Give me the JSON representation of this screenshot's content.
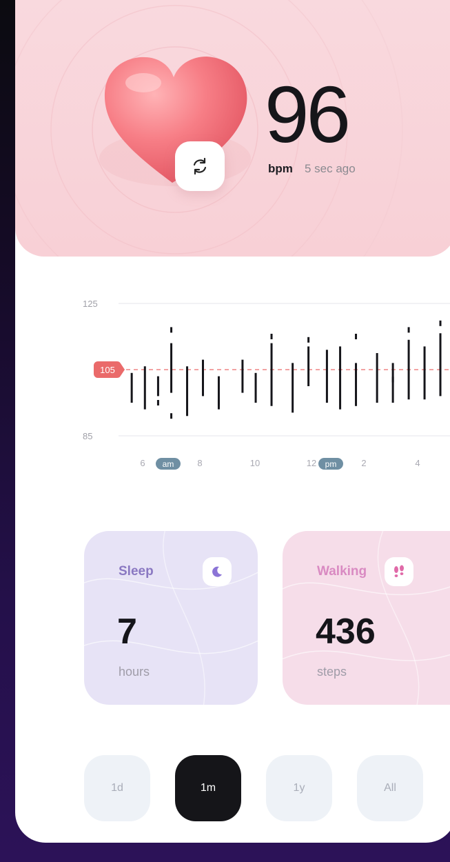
{
  "heart_rate": {
    "value": "96",
    "unit": "bpm",
    "updated": "5 sec ago"
  },
  "chart_data": {
    "type": "bar",
    "y_ticks": [
      "125",
      "105",
      "85"
    ],
    "ylim": [
      85,
      125
    ],
    "reference_value": 105,
    "reference_label": "105",
    "x_ticks": [
      "6",
      "8",
      "10",
      "12",
      "2",
      "4"
    ],
    "am_badge": "am",
    "pm_badge": "pm",
    "ranges": [
      {
        "x": 0.5,
        "low": 95,
        "high": 104
      },
      {
        "x": 1.0,
        "low": 93,
        "high": 106
      },
      {
        "x": 1.5,
        "low": 97,
        "high": 103
      },
      {
        "x": 2.0,
        "low": 98,
        "high": 113
      },
      {
        "x": 2.6,
        "low": 91,
        "high": 106
      },
      {
        "x": 3.2,
        "low": 97,
        "high": 108
      },
      {
        "x": 3.8,
        "low": 93,
        "high": 103
      },
      {
        "x": 4.7,
        "low": 98,
        "high": 108
      },
      {
        "x": 5.2,
        "low": 95,
        "high": 104
      },
      {
        "x": 5.8,
        "low": 94,
        "high": 113
      },
      {
        "x": 6.6,
        "low": 92,
        "high": 107
      },
      {
        "x": 7.2,
        "low": 100,
        "high": 112
      },
      {
        "x": 7.9,
        "low": 95,
        "high": 111
      },
      {
        "x": 8.4,
        "low": 93,
        "high": 112
      },
      {
        "x": 9.0,
        "low": 94,
        "high": 107
      },
      {
        "x": 9.8,
        "low": 95,
        "high": 110
      },
      {
        "x": 10.4,
        "low": 95,
        "high": 107
      },
      {
        "x": 11.0,
        "low": 96,
        "high": 114
      },
      {
        "x": 11.6,
        "low": 96,
        "high": 112
      },
      {
        "x": 12.2,
        "low": 97,
        "high": 116
      }
    ],
    "dots": [
      {
        "x": 2.0,
        "y": 117
      },
      {
        "x": 1.5,
        "y": 95
      },
      {
        "x": 2.0,
        "y": 91
      },
      {
        "x": 3.8,
        "y": 95
      },
      {
        "x": 5.8,
        "y": 115
      },
      {
        "x": 7.2,
        "y": 114
      },
      {
        "x": 9.0,
        "y": 115
      },
      {
        "x": 10.4,
        "y": 102
      },
      {
        "x": 11.0,
        "y": 117
      },
      {
        "x": 12.2,
        "y": 119
      }
    ]
  },
  "sleep": {
    "title": "Sleep",
    "value": "7",
    "unit": "hours",
    "icon": "moon-icon"
  },
  "walking": {
    "title": "Walking",
    "value": "436",
    "unit": "steps",
    "icon": "footsteps-icon"
  },
  "ranges": [
    "1d",
    "1m",
    "1y",
    "All"
  ],
  "active_range": "1m",
  "colors": {
    "hero_bg": "#f8d0d6",
    "reference": "#ea6a6a",
    "sleep_card": "#e7e3f6",
    "walk_card": "#f6dde9",
    "active_button": "#151519"
  }
}
